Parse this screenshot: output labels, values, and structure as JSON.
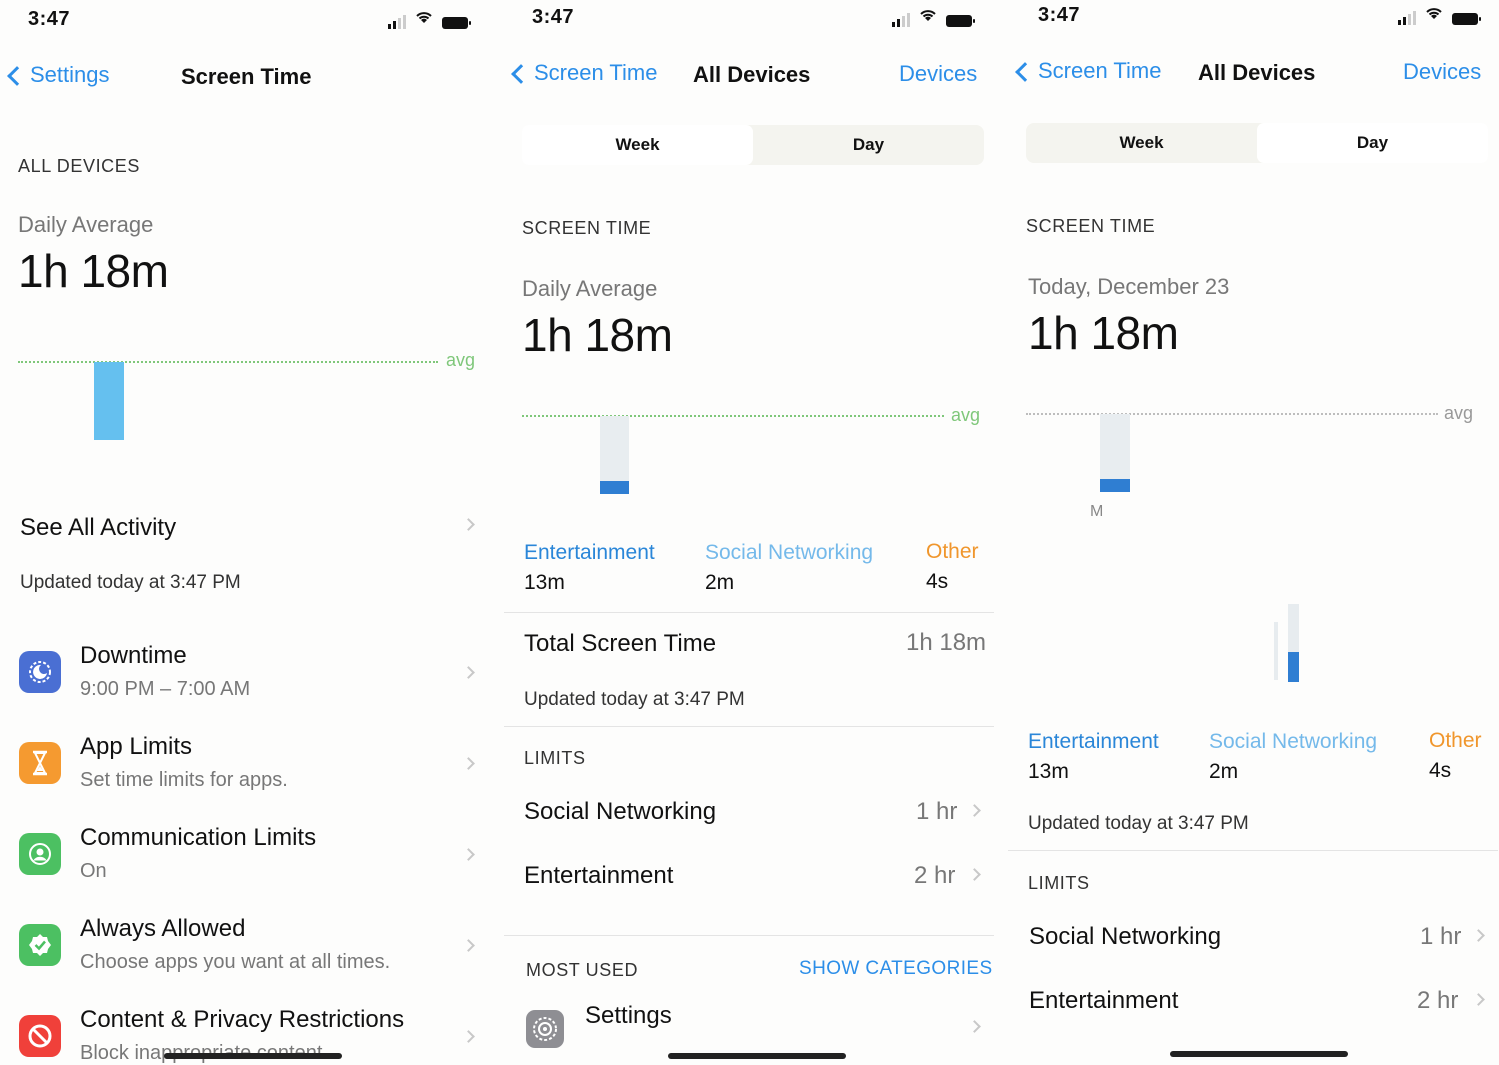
{
  "status": {
    "time": "3:47"
  },
  "screen1": {
    "back_label": "Settings",
    "title": "Screen Time",
    "section": "ALL DEVICES",
    "daily_label": "Daily Average",
    "daily_value": "1h 18m",
    "avg_label": "avg",
    "see_all": "See All Activity",
    "updated": "Updated today at 3:47 PM",
    "items": [
      {
        "title": "Downtime",
        "subtitle": "9:00 PM – 7:00 AM",
        "icon": "downtime-icon",
        "color": "#4a6fd3"
      },
      {
        "title": "App Limits",
        "subtitle": "Set time limits for apps.",
        "icon": "hourglass-icon",
        "color": "#f59a30"
      },
      {
        "title": "Communication Limits",
        "subtitle": "On",
        "icon": "contact-icon",
        "color": "#4cc062"
      },
      {
        "title": "Always Allowed",
        "subtitle": "Choose apps you want at all times.",
        "icon": "checkmark-icon",
        "color": "#4cc062"
      },
      {
        "title": "Content & Privacy Restrictions",
        "subtitle": "Block inappropriate content.",
        "icon": "restriction-icon",
        "color": "#f0403a"
      }
    ]
  },
  "screen2": {
    "back_label": "Screen Time",
    "title": "All Devices",
    "right": "Devices",
    "tabs": [
      "Week",
      "Day"
    ],
    "active_tab": "Week",
    "section": "SCREEN TIME",
    "daily_label": "Daily Average",
    "daily_value": "1h 18m",
    "avg_label": "avg",
    "categories": [
      {
        "name": "Entertainment",
        "value": "13m"
      },
      {
        "name": "Social Networking",
        "value": "2m"
      },
      {
        "name": "Other",
        "value": "4s"
      }
    ],
    "total_label": "Total Screen Time",
    "total_value": "1h 18m",
    "updated": "Updated today at 3:47 PM",
    "limits_header": "LIMITS",
    "limits": [
      {
        "name": "Social Networking",
        "value": "1 hr"
      },
      {
        "name": "Entertainment",
        "value": "2 hr"
      }
    ],
    "most_used": "MOST USED",
    "show_categories": "SHOW CATEGORIES",
    "app": "Settings"
  },
  "screen3": {
    "back_label": "Screen Time",
    "title": "All Devices",
    "right": "Devices",
    "tabs": [
      "Week",
      "Day"
    ],
    "active_tab": "Day",
    "section": "SCREEN TIME",
    "date_label": "Today, December 23",
    "daily_value": "1h 18m",
    "avg_label": "avg",
    "day_initial": "M",
    "categories": [
      {
        "name": "Entertainment",
        "value": "13m"
      },
      {
        "name": "Social Networking",
        "value": "2m"
      },
      {
        "name": "Other",
        "value": "4s"
      }
    ],
    "updated": "Updated today at 3:47 PM",
    "limits_header": "LIMITS",
    "limits": [
      {
        "name": "Social Networking",
        "value": "1 hr"
      },
      {
        "name": "Entertainment",
        "value": "2 hr"
      }
    ]
  }
}
